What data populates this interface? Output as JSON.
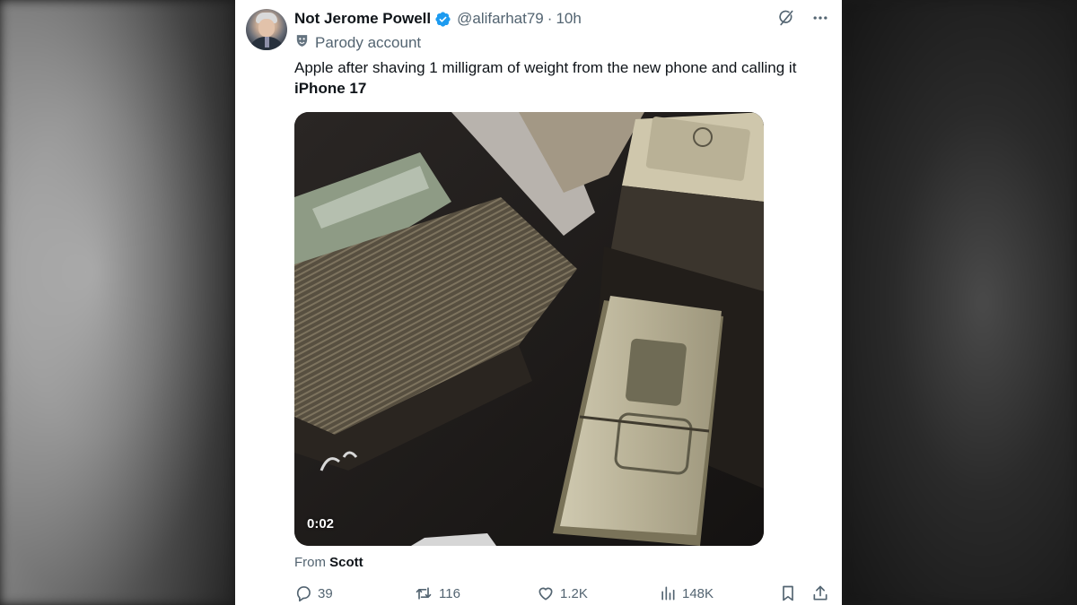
{
  "tweet": {
    "display_name": "Not Jerome Powell",
    "handle": "@alifarhat79",
    "separator": "·",
    "time": "10h",
    "parody_label": "Parody account",
    "text_line1": "Apple after shaving 1 milligram of weight from the new phone and calling it",
    "text_bold": "iPhone 17",
    "video_time": "0:02",
    "from_label": "From",
    "from_name": "Scott"
  },
  "stats": {
    "replies": "39",
    "reposts": "116",
    "likes": "1.2K",
    "views": "148K"
  },
  "icons": {
    "verified": "verified-badge-icon",
    "grok": "grok-icon",
    "more": "more-icon",
    "parody": "parody-mask-icon",
    "reply": "reply-icon",
    "repost": "repost-icon",
    "like": "like-icon",
    "views": "views-icon",
    "bookmark": "bookmark-icon",
    "share": "share-icon"
  },
  "colors": {
    "verified": "#1d9bf0",
    "text": "#0f1419",
    "muted": "#536471"
  }
}
